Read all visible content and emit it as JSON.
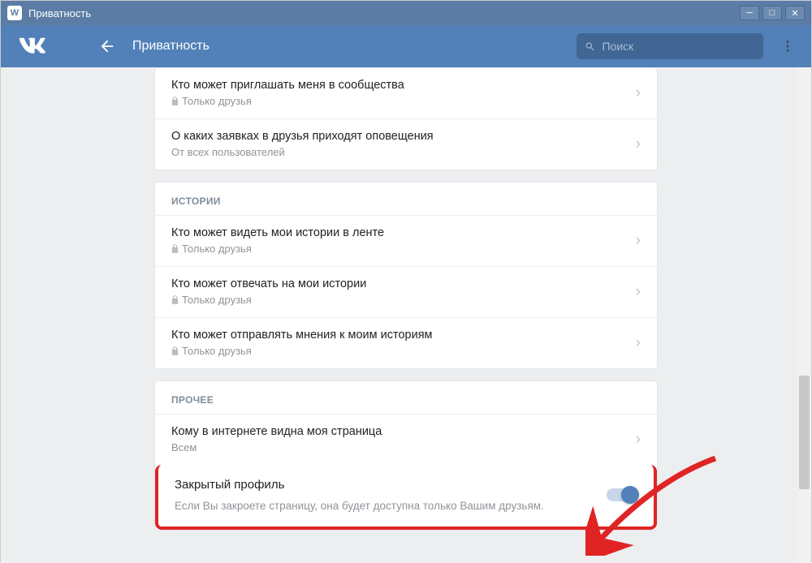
{
  "window": {
    "title": "Приватность"
  },
  "header": {
    "page_title": "Приватность",
    "search_placeholder": "Поиск"
  },
  "groups": [
    {
      "header": null,
      "rows": [
        {
          "title": "Кто может приглашать меня в сообщества",
          "value": "Только друзья",
          "locked": true
        },
        {
          "title": "О каких заявках в друзья приходят оповещения",
          "value": "От всех пользователей",
          "locked": false
        }
      ]
    },
    {
      "header": "ИСТОРИИ",
      "rows": [
        {
          "title": "Кто может видеть мои истории в ленте",
          "value": "Только друзья",
          "locked": true
        },
        {
          "title": "Кто может отвечать на мои истории",
          "value": "Только друзья",
          "locked": true
        },
        {
          "title": "Кто может отправлять мнения к моим историям",
          "value": "Только друзья",
          "locked": true
        }
      ]
    },
    {
      "header": "ПРОЧЕЕ",
      "rows": [
        {
          "title": "Кому в интернете видна моя страница",
          "value": "Всем",
          "locked": false
        }
      ],
      "closed_profile": {
        "title": "Закрытый профиль",
        "description": "Если Вы закроете страницу, она будет доступна только Вашим друзьям."
      }
    }
  ]
}
